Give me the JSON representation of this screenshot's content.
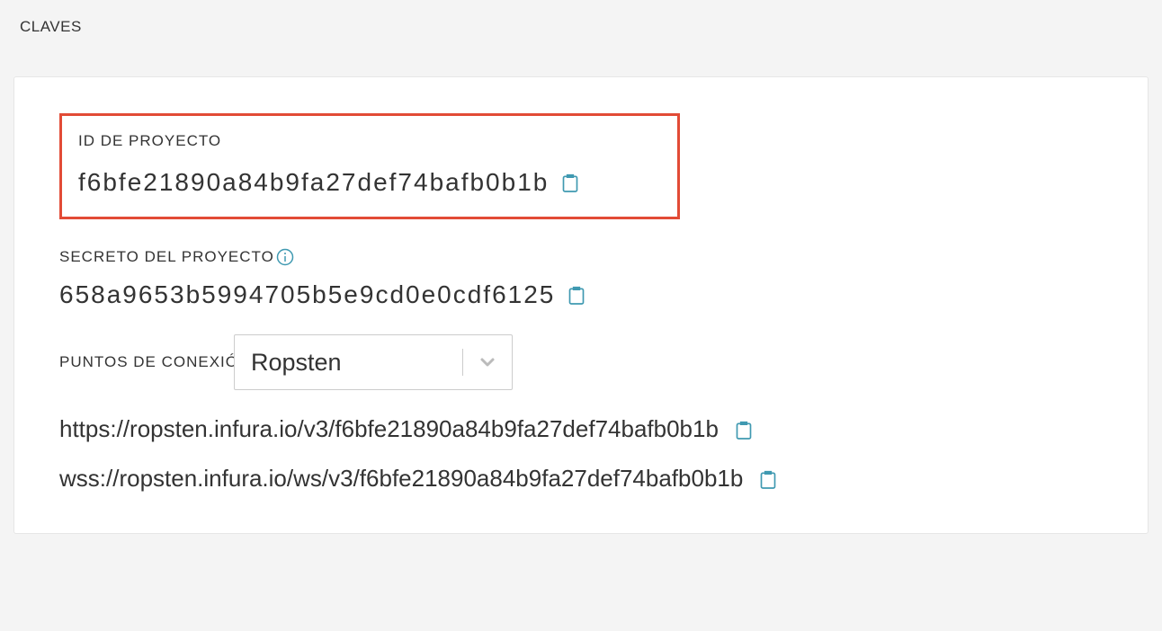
{
  "header": {
    "title": "CLAVES"
  },
  "project_id": {
    "label": "ID DE PROYECTO",
    "value": "f6bfe21890a84b9fa27def74bafb0b1b"
  },
  "project_secret": {
    "label": "SECRETO DEL PROYECTO",
    "value": "658a9653b5994705b5e9cd0e0cdf6125"
  },
  "endpoints": {
    "label": "PUNTOS DE CONEXIÓN",
    "selected": "Ropsten",
    "https": "https://ropsten.infura.io/v3/f6bfe21890a84b9fa27def74bafb0b1b",
    "wss": "wss://ropsten.infura.io/ws/v3/f6bfe21890a84b9fa27def74bafb0b1b"
  },
  "colors": {
    "highlight": "#e24b36",
    "icon": "#3f99b1"
  }
}
